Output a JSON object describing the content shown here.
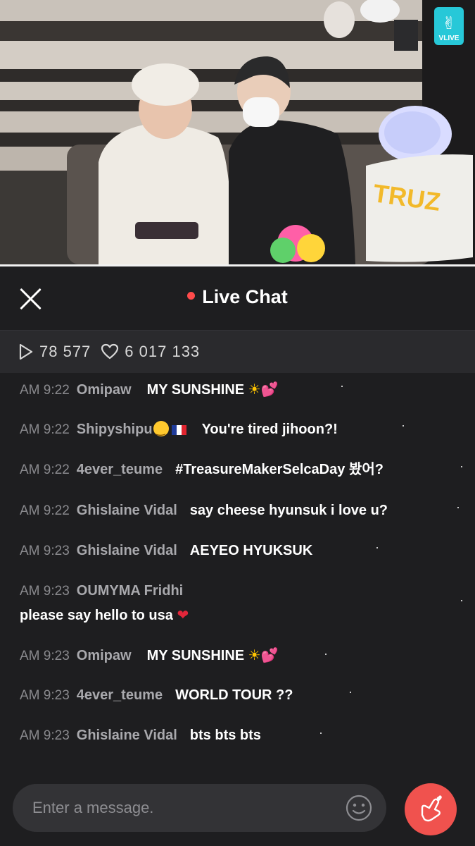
{
  "video": {
    "badge_label": "VLIVE",
    "pillow_text": "TRUZ"
  },
  "header": {
    "title": "Live Chat"
  },
  "stats": {
    "views": "78 577",
    "likes": "6 017 133"
  },
  "chat": {
    "messages": [
      {
        "time": "AM 9:22",
        "user": "Omipaw",
        "text": "MY SUNSHINE"
      },
      {
        "time": "AM 9:22",
        "user": "Shipyshipu",
        "text": "You're tired jihoon?!"
      },
      {
        "time": "AM 9:22",
        "user": "4ever_teume",
        "text": "#TreasureMakerSelcaDay 봤어?"
      },
      {
        "time": "AM 9:22",
        "user": "Ghislaine Vidal",
        "text": "say cheese hyunsuk i love u?"
      },
      {
        "time": "AM 9:23",
        "user": "Ghislaine Vidal",
        "text": "AEYEO HYUKSUK"
      },
      {
        "time": "AM 9:23",
        "user": "OUMYMA Fridhi",
        "text": "please say hello to usa"
      },
      {
        "time": "AM 9:23",
        "user": "Omipaw",
        "text": "MY SUNSHINE"
      },
      {
        "time": "AM 9:23",
        "user": "4ever_teume",
        "text": "WORLD TOUR ??"
      },
      {
        "time": "AM 9:23",
        "user": "Ghislaine Vidal",
        "text": "bts bts bts"
      }
    ]
  },
  "input": {
    "placeholder": "Enter a message."
  },
  "icons": {
    "close": "close-icon",
    "views": "play-icon",
    "likes": "heart-outline-icon",
    "emoji": "smiley-icon",
    "send_heart": "finger-heart-icon"
  },
  "colors": {
    "background": "#1e1e20",
    "live_dot": "#ff4b4b",
    "heart_button": "#f0524e",
    "vlive_badge": "#27c8d8"
  }
}
